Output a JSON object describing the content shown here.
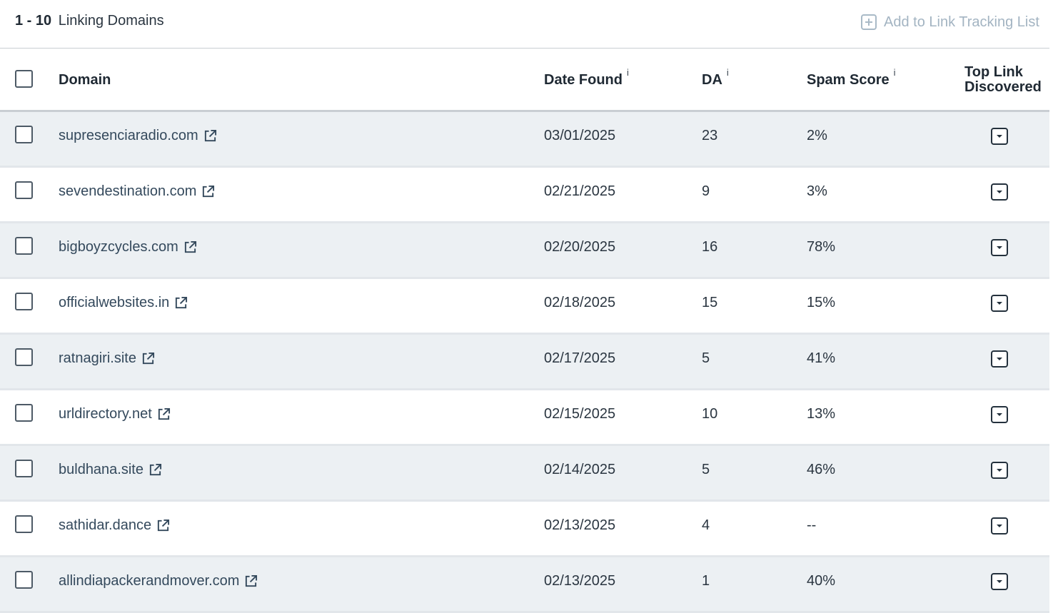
{
  "header": {
    "range": "1 - 10",
    "title": "Linking Domains",
    "add_tracking_label": "Add to Link Tracking List"
  },
  "columns": {
    "domain": "Domain",
    "date_found": "Date Found",
    "da": "DA",
    "spam_score": "Spam Score",
    "top_link_line1": "Top Link",
    "top_link_line2": "Discovered",
    "info_marker": "i"
  },
  "rows": [
    {
      "domain": "supresenciaradio.com",
      "date": "03/01/2025",
      "da": "23",
      "spam": "2%"
    },
    {
      "domain": "sevendestination.com",
      "date": "02/21/2025",
      "da": "9",
      "spam": "3%"
    },
    {
      "domain": "bigboyzcycles.com",
      "date": "02/20/2025",
      "da": "16",
      "spam": "78%"
    },
    {
      "domain": "officialwebsites.in",
      "date": "02/18/2025",
      "da": "15",
      "spam": "15%"
    },
    {
      "domain": "ratnagiri.site",
      "date": "02/17/2025",
      "da": "5",
      "spam": "41%"
    },
    {
      "domain": "urldirectory.net",
      "date": "02/15/2025",
      "da": "10",
      "spam": "13%"
    },
    {
      "domain": "buldhana.site",
      "date": "02/14/2025",
      "da": "5",
      "spam": "46%"
    },
    {
      "domain": "sathidar.dance",
      "date": "02/13/2025",
      "da": "4",
      "spam": "--"
    },
    {
      "domain": "allindiapackerandmover.com",
      "date": "02/13/2025",
      "da": "1",
      "spam": "40%"
    }
  ],
  "icons": {
    "add": "plus-square-icon",
    "external": "external-link-icon",
    "expand": "chevron-down-icon"
  },
  "colors": {
    "row_alt": "#ecf0f3",
    "link": "#34495c",
    "muted": "#a3b4c2"
  }
}
